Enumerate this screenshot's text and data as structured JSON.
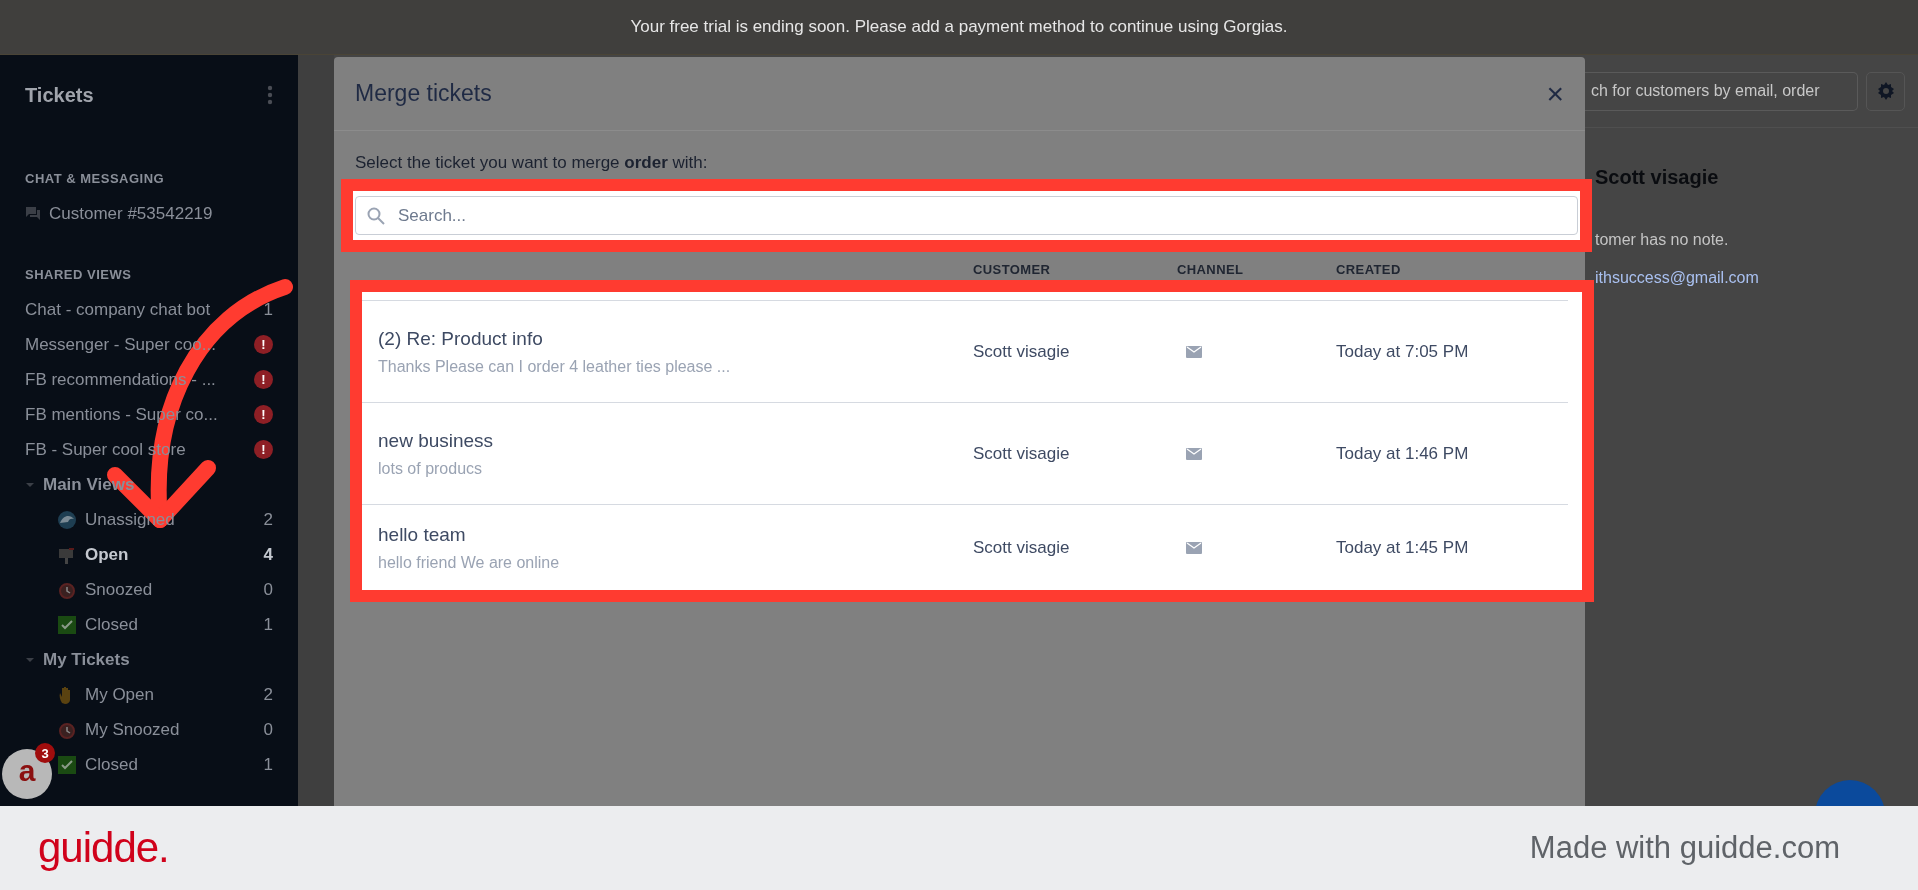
{
  "banner": {
    "text": "Your free trial is ending soon. Please add a payment method to continue using Gorgias."
  },
  "sidebar": {
    "title": "Tickets",
    "chat_section": {
      "heading": "CHAT & MESSAGING",
      "items": [
        {
          "label": "Customer #53542219"
        }
      ]
    },
    "shared_section": {
      "heading": "SHARED VIEWS",
      "items": [
        {
          "label": "Chat - company chat bot",
          "count": "1"
        },
        {
          "label": "Messenger - Super coo...",
          "badge": "!"
        },
        {
          "label": "FB recommendations - ...",
          "badge": "!"
        },
        {
          "label": "FB mentions - Super co...",
          "badge": "!"
        },
        {
          "label": "FB - Super cool store",
          "badge": "!"
        }
      ]
    },
    "groups": [
      {
        "label": "Main Views",
        "expanded": true,
        "items": [
          {
            "label": "Unassigned",
            "count": "2",
            "selected": false
          },
          {
            "label": "Open",
            "count": "4",
            "selected": true
          },
          {
            "label": "Snoozed",
            "count": "0",
            "selected": false
          },
          {
            "label": "Closed",
            "count": "1",
            "selected": false
          }
        ]
      },
      {
        "label": "My Tickets",
        "expanded": true,
        "items": [
          {
            "label": "My Open",
            "count": "2",
            "selected": false
          },
          {
            "label": "My Snoozed",
            "count": "0",
            "selected": false
          },
          {
            "label": "Closed",
            "count": "1",
            "selected": false
          }
        ]
      }
    ],
    "avatar": {
      "letter": "a",
      "badge": "3"
    }
  },
  "modal": {
    "title": "Merge tickets",
    "close": "×",
    "instruction": "Select the ticket you want to merge **order** with:",
    "search": {
      "placeholder": "Search..."
    },
    "columns": [
      "CUSTOMER",
      "CHANNEL",
      "CREATED"
    ],
    "rows": [
      {
        "title": "(2) Re: Product info",
        "preview": "Thanks Please can I order 4 leather ties please ...",
        "customer": "Scott visagie",
        "created": "Today at 7:05 PM"
      },
      {
        "title": "new business",
        "preview": "lots of producs",
        "customer": "Scott visagie",
        "created": "Today at 1:46 PM"
      },
      {
        "title": "hello team",
        "preview": "hello friend We are online",
        "customer": "Scott visagie",
        "created": "Today at 1:45 PM"
      }
    ]
  },
  "customer_panel": {
    "search": {
      "placeholder": "ch for customers by email, order"
    },
    "name": "Scott visagie",
    "note": "tomer has no note.",
    "email": "ithsuccess@gmail.com"
  },
  "footer": {
    "logo": "guidde.",
    "credit": "Made with guidde.com"
  }
}
